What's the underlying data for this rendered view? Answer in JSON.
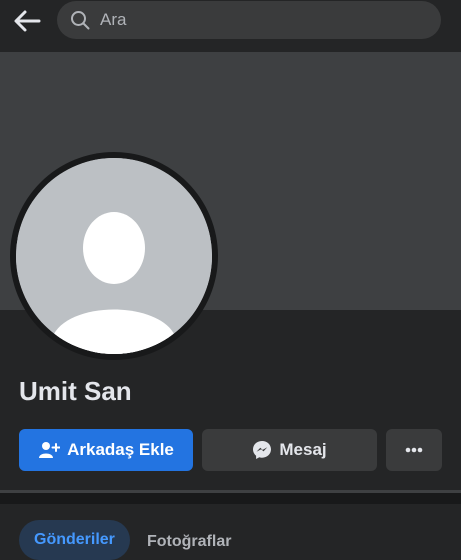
{
  "search": {
    "placeholder": "Ara"
  },
  "profile": {
    "name": "Umit San"
  },
  "actions": {
    "add_friend": "Arkadaş Ekle",
    "message": "Mesaj"
  },
  "tabs": [
    {
      "label": "Gönderiler",
      "active": true
    },
    {
      "label": "Fotoğraflar",
      "active": false
    }
  ],
  "icons": {
    "back": "back-arrow-icon",
    "search": "search-icon",
    "add_friend": "add-friend-icon",
    "messenger": "messenger-icon",
    "more": "more-dots-icon"
  },
  "colors": {
    "accent": "#2374e1",
    "background": "#242526",
    "cover": "#3e4042",
    "secondary_button": "#3a3b3c",
    "active_tab_text": "#4599ff"
  }
}
